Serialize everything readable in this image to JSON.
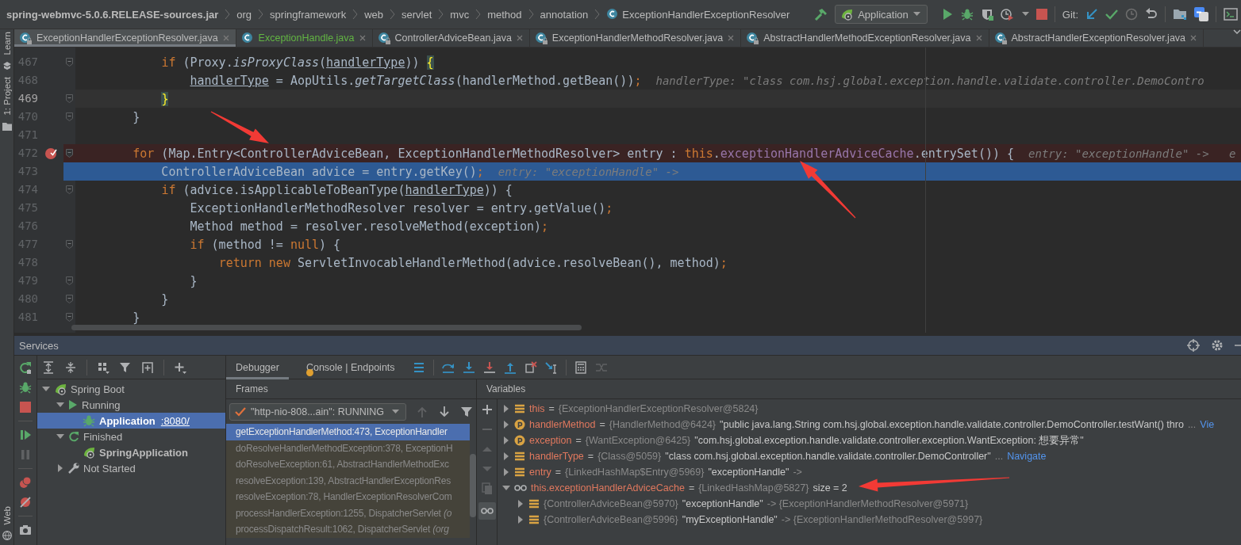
{
  "breadcrumbs": [
    {
      "label": "spring-webmvc-5.0.6.RELEASE-sources.jar",
      "kind": "archive"
    },
    {
      "label": "org",
      "kind": "package"
    },
    {
      "label": "springframework",
      "kind": "package"
    },
    {
      "label": "web",
      "kind": "package"
    },
    {
      "label": "servlet",
      "kind": "package"
    },
    {
      "label": "mvc",
      "kind": "package"
    },
    {
      "label": "method",
      "kind": "package"
    },
    {
      "label": "annotation",
      "kind": "package"
    },
    {
      "label": "ExceptionHandlerExceptionResolver",
      "kind": "class"
    }
  ],
  "toolbar": {
    "run_configuration": "Application",
    "vcs_label": "Git:"
  },
  "tool_strip": {
    "top": [
      "Learn",
      "1: Project"
    ],
    "bottom": [
      "Web"
    ]
  },
  "editor_tabs": [
    {
      "label": "ExceptionHandlerExceptionResolver.java",
      "selected": true,
      "read_only": true,
      "color": "#bbbbbb"
    },
    {
      "label": "ExceptionHandle.java",
      "selected": false,
      "read_only": false,
      "color": "#62b543"
    },
    {
      "label": "ControllerAdviceBean.java",
      "selected": false,
      "read_only": true,
      "color": "#bbbbbb"
    },
    {
      "label": "ExceptionHandlerMethodResolver.java",
      "selected": false,
      "read_only": true,
      "color": "#bbbbbb"
    },
    {
      "label": "AbstractHandlerMethodExceptionResolver.java",
      "selected": false,
      "read_only": true,
      "color": "#bbbbbb"
    },
    {
      "label": "AbstractHandlerExceptionResolver.java",
      "selected": false,
      "read_only": true,
      "color": "#bbbbbb"
    }
  ],
  "editor": {
    "lines": [
      {
        "number": "467",
        "fold": true,
        "breakpoint": false,
        "execution_point": false,
        "caret_line": false,
        "tokens": [
          {
            "text": "            if",
            "kind": "keyword"
          },
          {
            "text": " (Proxy.",
            "kind": "plain"
          },
          {
            "text": "isProxyClass",
            "kind": "italic"
          },
          {
            "text": "(",
            "kind": "plain"
          },
          {
            "text": "handlerType",
            "kind": "underline"
          },
          {
            "text": ")) ",
            "kind": "plain"
          },
          {
            "text": "{",
            "kind": "brace"
          }
        ]
      },
      {
        "number": "468",
        "fold": false,
        "breakpoint": false,
        "execution_point": false,
        "caret_line": false,
        "tokens": [
          {
            "text": "                handlerType",
            "kind": "underline"
          },
          {
            "text": " = AopUtils.",
            "kind": "plain"
          },
          {
            "text": "getTargetClass",
            "kind": "italic"
          },
          {
            "text": "(handlerMethod.getBean())",
            "kind": "plain"
          },
          {
            "text": ";",
            "kind": "punct"
          }
        ],
        "hint": "handlerType: \"class com.hsj.global.exception.handle.validate.controller.DemoContro"
      },
      {
        "number": "469",
        "fold": true,
        "breakpoint": false,
        "execution_point": false,
        "caret_line": true,
        "tokens": [
          {
            "text": "            }",
            "kind": "brace"
          }
        ]
      },
      {
        "number": "470",
        "fold": true,
        "breakpoint": false,
        "execution_point": false,
        "caret_line": false,
        "tokens": [
          {
            "text": "        }",
            "kind": "plain"
          }
        ]
      },
      {
        "number": "471",
        "fold": false,
        "breakpoint": false,
        "execution_point": false,
        "caret_line": false
      },
      {
        "number": "472",
        "fold": true,
        "breakpoint": true,
        "execution_point": false,
        "caret_line": false,
        "tokens": [
          {
            "text": "        for",
            "kind": "keyword"
          },
          {
            "text": " (Map.Entry<ControllerAdviceBean, ExceptionHandlerMethodResolver> entry : ",
            "kind": "plain"
          },
          {
            "text": "this",
            "kind": "keyword"
          },
          {
            "text": ".",
            "kind": "plain"
          },
          {
            "text": "exceptionHandlerAdviceCache",
            "kind": "field"
          },
          {
            "text": ".entrySet()) {",
            "kind": "plain"
          }
        ],
        "hint": "entry: \"exceptionHandle\" ->   e"
      },
      {
        "number": "473",
        "fold": false,
        "breakpoint": false,
        "execution_point": true,
        "caret_line": false,
        "tokens": [
          {
            "text": "            ControllerAdviceBean advice = entry.getKey()",
            "kind": "plain"
          },
          {
            "text": ";",
            "kind": "punct"
          }
        ],
        "hint": "entry: \"exceptionHandle\" ->"
      },
      {
        "number": "474",
        "fold": true,
        "breakpoint": false,
        "execution_point": false,
        "caret_line": false,
        "tokens": [
          {
            "text": "            if",
            "kind": "keyword"
          },
          {
            "text": " (advice.isApplicableToBeanType(",
            "kind": "plain"
          },
          {
            "text": "handlerType",
            "kind": "underline"
          },
          {
            "text": ")) {",
            "kind": "plain"
          }
        ]
      },
      {
        "number": "475",
        "fold": false,
        "breakpoint": false,
        "execution_point": false,
        "caret_line": false,
        "tokens": [
          {
            "text": "                ExceptionHandlerMethodResolver resolver = entry.getValue()",
            "kind": "plain"
          },
          {
            "text": ";",
            "kind": "punct"
          }
        ]
      },
      {
        "number": "476",
        "fold": false,
        "breakpoint": false,
        "execution_point": false,
        "caret_line": false,
        "tokens": [
          {
            "text": "                Method method = resolver.resolveMethod(exception)",
            "kind": "plain"
          },
          {
            "text": ";",
            "kind": "punct"
          }
        ]
      },
      {
        "number": "477",
        "fold": true,
        "breakpoint": false,
        "execution_point": false,
        "caret_line": false,
        "tokens": [
          {
            "text": "                if",
            "kind": "keyword"
          },
          {
            "text": " (method != ",
            "kind": "plain"
          },
          {
            "text": "null",
            "kind": "keyword"
          },
          {
            "text": ") {",
            "kind": "plain"
          }
        ]
      },
      {
        "number": "478",
        "fold": false,
        "breakpoint": false,
        "execution_point": false,
        "caret_line": false,
        "tokens": [
          {
            "text": "                    return new",
            "kind": "keyword"
          },
          {
            "text": " ServletInvocableHandlerMethod(advice.resolveBean(), method)",
            "kind": "plain"
          },
          {
            "text": ";",
            "kind": "punct"
          }
        ]
      },
      {
        "number": "479",
        "fold": true,
        "breakpoint": false,
        "execution_point": false,
        "caret_line": false,
        "tokens": [
          {
            "text": "                }",
            "kind": "plain"
          }
        ]
      },
      {
        "number": "480",
        "fold": true,
        "breakpoint": false,
        "execution_point": false,
        "caret_line": false,
        "tokens": [
          {
            "text": "            }",
            "kind": "plain"
          }
        ]
      },
      {
        "number": "481",
        "fold": true,
        "breakpoint": false,
        "execution_point": false,
        "caret_line": false,
        "tokens": [
          {
            "text": "        }",
            "kind": "plain"
          }
        ]
      }
    ]
  },
  "services": {
    "title": "Services",
    "tree": [
      {
        "label": "Spring Boot",
        "kind": "group",
        "expanded": true,
        "selected": false,
        "children": [
          {
            "label": "Running",
            "kind": "running",
            "expanded": true,
            "selected": false,
            "children": [
              {
                "label": "Application",
                "port": ":8080/",
                "kind": "debug-app",
                "selected": true
              }
            ]
          },
          {
            "label": "Finished",
            "kind": "finished",
            "expanded": true,
            "selected": false,
            "children": [
              {
                "label": "SpringApplication",
                "kind": "app",
                "selected": false
              }
            ]
          },
          {
            "label": "Not Started",
            "kind": "not-started",
            "expanded": false,
            "selected": false
          }
        ]
      }
    ],
    "debugger": {
      "tabs": [
        {
          "label": "Debugger",
          "selected": true,
          "warning": false
        },
        {
          "label": "Console | Endpoints",
          "selected": false,
          "warning": true
        }
      ],
      "frames": {
        "title": "Frames",
        "thread": "\"http-nio-808...ain\": RUNNING",
        "items": [
          {
            "text": "getExceptionHandlerMethod:473, ExceptionHandler",
            "selected": true,
            "kind": "library"
          },
          {
            "text": "doResolveHandlerMethodException:378, ExceptionH",
            "selected": false,
            "kind": "library"
          },
          {
            "text": "doResolveException:61, AbstractHandlerMethodExc",
            "selected": false,
            "kind": "library"
          },
          {
            "text": "resolveException:139, AbstractHandlerExceptionRes",
            "selected": false,
            "kind": "library"
          },
          {
            "text": "resolveException:78, HandlerExceptionResolverCom",
            "selected": false,
            "kind": "library"
          },
          {
            "text": "processHandlerException:1255, DispatcherServlet *(o*",
            "selected": false,
            "kind": "library"
          },
          {
            "text": "processDispatchResult:1062, DispatcherServlet *(org*",
            "selected": false,
            "kind": "library"
          }
        ]
      },
      "variables": {
        "title": "Variables",
        "items": [
          {
            "kind": "field",
            "name": "this",
            "op": "=",
            "type": "{ExceptionHandlerExceptionResolver@5824}",
            "expanded": false
          },
          {
            "kind": "param",
            "name": "handlerMethod",
            "op": "=",
            "type": "{HandlerMethod@6424}",
            "value": "\"public java.lang.String com.hsj.global.exception.handle.validate.controller.DemoController.testWant() thro",
            "suffix": "...",
            "link": "Vie",
            "expanded": false
          },
          {
            "kind": "param",
            "name": "exception",
            "op": "=",
            "type": "{WantException@6425}",
            "value": "\"com.hsj.global.exception.handle.validate.controller.exception.WantException: 想要异常\"",
            "expanded": false
          },
          {
            "kind": "field",
            "name": "handlerType",
            "op": "=",
            "type": "{Class@5059}",
            "value": "\"class com.hsj.global.exception.handle.validate.controller.DemoController\"",
            "suffix": "...",
            "link": "Navigate",
            "expanded": false
          },
          {
            "kind": "field",
            "name": "entry",
            "op": "=",
            "type": "{LinkedHashMap$Entry@5969}",
            "value": "\"exceptionHandle\"",
            "suffix": "->",
            "expanded": false
          },
          {
            "kind": "watch",
            "name": "this.exceptionHandlerAdviceCache",
            "op": "=",
            "type": "{LinkedHashMap@5827}",
            "value": "size = 2",
            "expanded": true,
            "children": [
              {
                "kind": "field",
                "type": "{ControllerAdviceBean@5970}",
                "value": "\"exceptionHandle\"",
                "suffix": "-> {ExceptionHandlerMethodResolver@5971}",
                "expanded": false
              },
              {
                "kind": "field",
                "type": "{ControllerAdviceBean@5996}",
                "value": "\"myExceptionHandle\"",
                "suffix": "-> {ExceptionHandlerMethodResolver@5997}",
                "expanded": false
              }
            ]
          }
        ]
      }
    }
  }
}
